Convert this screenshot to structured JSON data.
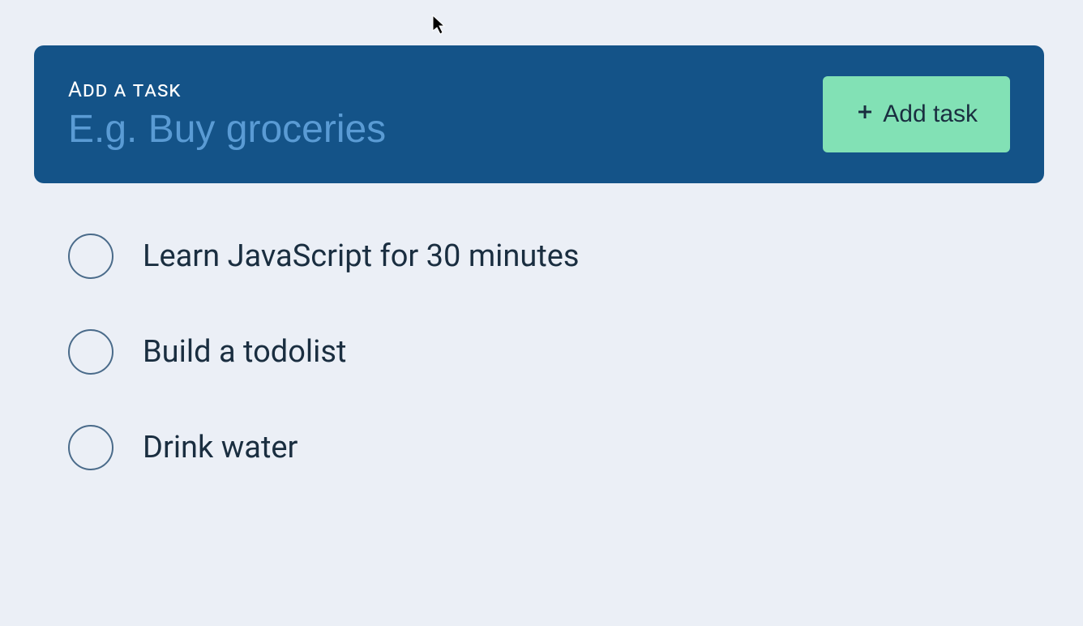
{
  "addTask": {
    "label": "Add a task",
    "placeholder": "E.g. Buy groceries",
    "value": "",
    "buttonLabel": "Add task"
  },
  "tasks": [
    {
      "text": "Learn JavaScript for 30 minutes",
      "completed": false
    },
    {
      "text": "Build a todolist",
      "completed": false
    },
    {
      "text": "Drink water",
      "completed": false
    }
  ],
  "colors": {
    "background": "#ebeff6",
    "panel": "#145388",
    "button": "#82e1b5",
    "placeholder": "#5a9bd4",
    "text": "#1a2e40"
  }
}
